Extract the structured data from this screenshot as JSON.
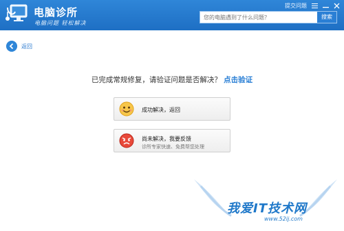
{
  "app": {
    "title": "电脑诊所",
    "slogan": "电脑问题 轻松解决"
  },
  "topbar": {
    "feedback_label": "提交问题"
  },
  "search": {
    "placeholder": "您的电脑遇到了什么问题？",
    "button_label": "搜索"
  },
  "nav": {
    "back_label": "返回"
  },
  "question": {
    "text": "已完成常规修复，请验证问题是否解决？",
    "link": "点击验证"
  },
  "options": {
    "solved": {
      "title": "成功解决，返回"
    },
    "unsolved": {
      "title": "尚未解决，我要反馈",
      "subtitle": "诊所专家快速、免费帮您处理"
    }
  },
  "watermark": {
    "main": "我爱IT技术网",
    "url": "www.52ij.com"
  },
  "colors": {
    "header": "#1e6fc4",
    "accent": "#2a7fd5"
  }
}
